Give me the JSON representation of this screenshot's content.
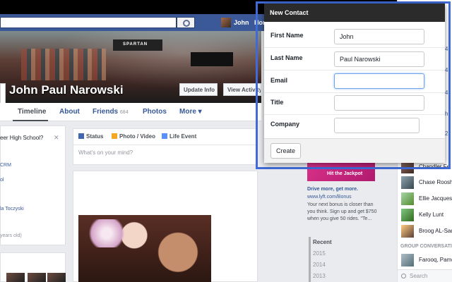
{
  "topbar": {
    "user_name": "John",
    "home_label": "Hom"
  },
  "profile": {
    "name": "John Paul Narowski",
    "update_info_label": "Update Info",
    "view_activity_label": "View Activity L",
    "cover_banner": "SPARTAN"
  },
  "tabs": [
    {
      "label": "Timeline"
    },
    {
      "label": "About"
    },
    {
      "label": "Friends",
      "count": "684"
    },
    {
      "label": "Photos"
    },
    {
      "label": "More ▾"
    }
  ],
  "left": {
    "question": "eer High School?",
    "close": "✕",
    "links": [
      "CRM",
      "ol",
      "la Toczyski"
    ],
    "age": "years old)"
  },
  "composer": {
    "status": "Status",
    "photo_video": "Photo / Video",
    "life_event": "Life Event",
    "placeholder": "What's on your mind?"
  },
  "ad": {
    "image_caption": "Hit the Jackpot",
    "title": "Drive more, get more.",
    "url": "www.lyft.com/Bonus",
    "body": "Your next bonus is closer than you think. Sign up and get $750 when you give 50 rides. \"Te..."
  },
  "years": [
    "Recent",
    "2015",
    "2014",
    "2013"
  ],
  "chat": {
    "numbers": [
      "4",
      "4",
      "4",
      "h",
      "2"
    ],
    "people": [
      "Chandler Fe",
      "Chase Roosh",
      "Ellie Jacques",
      "Kelly Lunt",
      "Broog AL-Sad"
    ],
    "group_header": "GROUP CONVERSATI",
    "group_item": "Farooq, Pame",
    "search_label": "Search"
  },
  "dialog": {
    "title": "New Contact",
    "first_name_label": "First Name",
    "first_name_value": "John",
    "last_name_label": "Last Name",
    "last_name_value": "Paul Narowski",
    "email_label": "Email",
    "email_value": "",
    "title_label": "Title",
    "title_value": "",
    "company_label": "Company",
    "company_value": "",
    "create_label": "Create"
  },
  "colors": {
    "fb_blue": "#3b5998",
    "dialog_header": "#2b2b2b",
    "highlight_frame": "#3f6ad8"
  }
}
